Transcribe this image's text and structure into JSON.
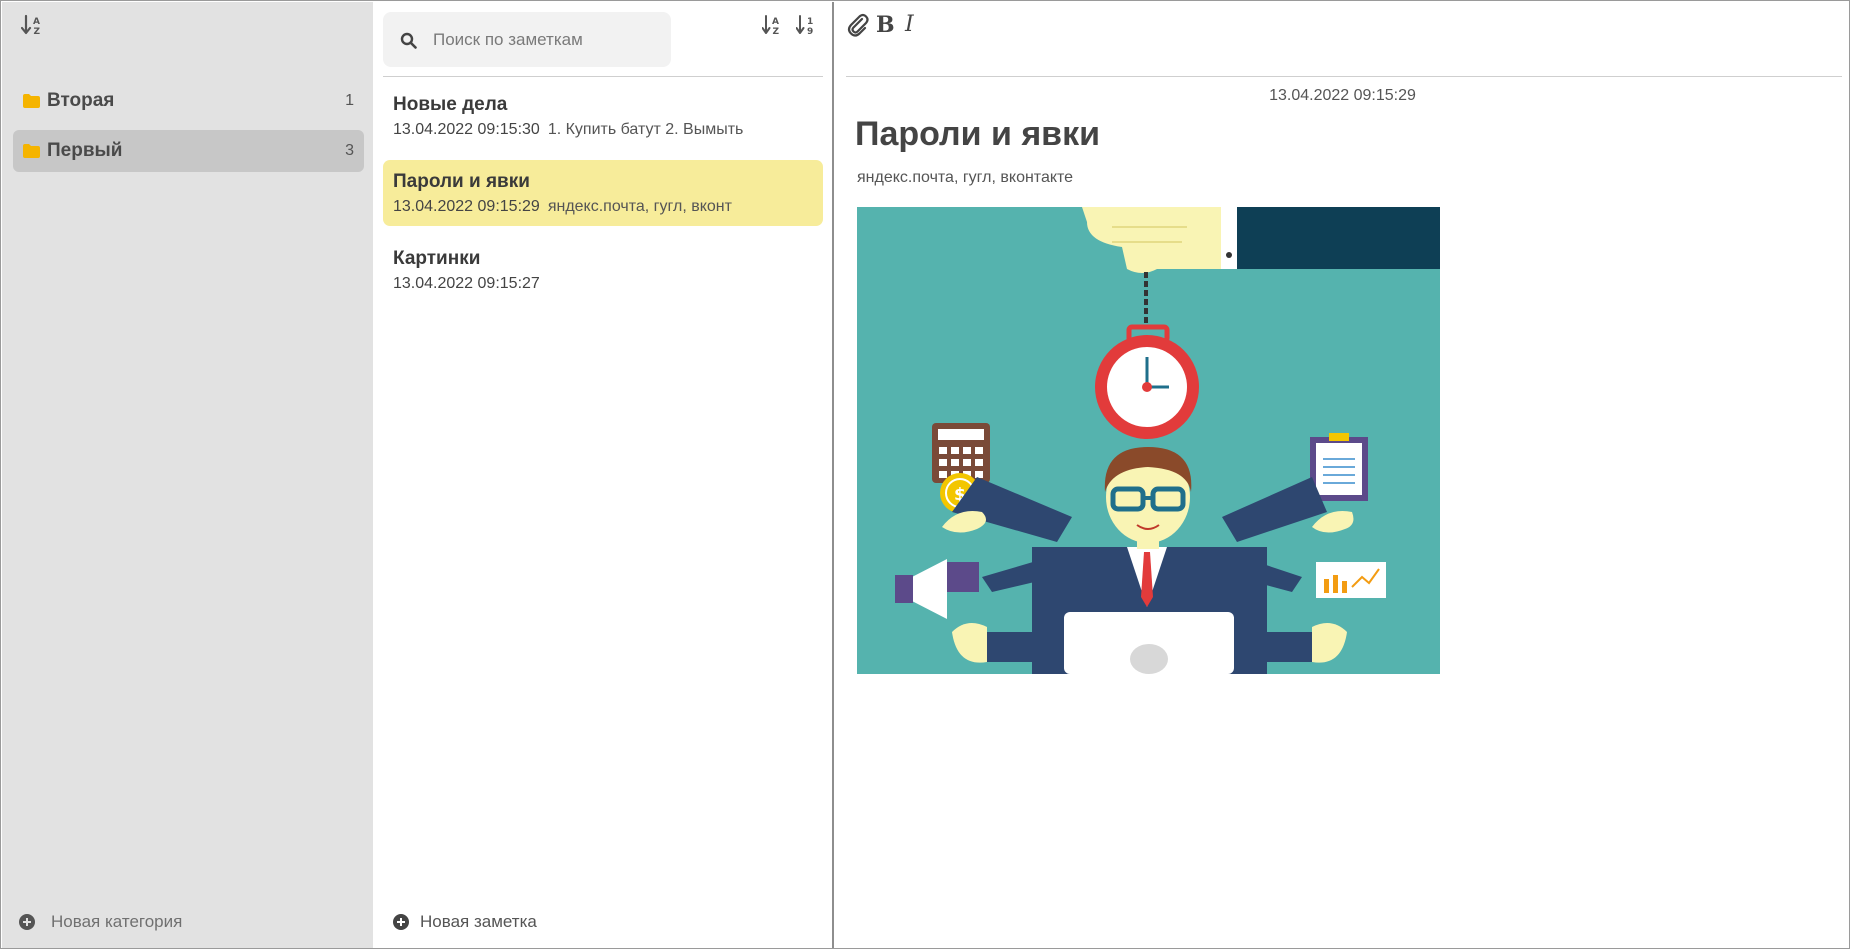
{
  "sidebar": {
    "categories": [
      {
        "label": "Вторая",
        "count": "1"
      },
      {
        "label": "Первый",
        "count": "3"
      }
    ],
    "new_category_label": "Новая категория"
  },
  "notes": {
    "search_placeholder": "Поиск по заметкам",
    "items": [
      {
        "title": "Новые дела",
        "date": "13.04.2022 09:15:30",
        "preview": "1. Купить батут 2. Вымыть"
      },
      {
        "title": "Пароли и явки",
        "date": "13.04.2022 09:15:29",
        "preview": "яндекс.почта, гугл, вконт"
      },
      {
        "title": "Картинки",
        "date": "13.04.2022 09:15:27",
        "preview": ""
      }
    ],
    "new_note_label": "Новая заметка"
  },
  "editor": {
    "date": "13.04.2022 09:15:29",
    "heading": "Пароли и явки",
    "body": "яндекс.почта, гугл, вконтакте",
    "bold_label": "B",
    "italic_label": "I"
  },
  "colors": {
    "sidebar_bg": "#e2e2e2",
    "active_category": "#c7c7c7",
    "active_note": "#f7ec9a",
    "folder_icon": "#f5b400",
    "illustration_bg": "#55b3ae"
  },
  "icons": {
    "sort_categories": "sort-alpha-icon",
    "folder": "folder-icon",
    "search": "search-icon",
    "sort_notes_alpha": "sort-alpha-icon",
    "sort_notes_numeric": "sort-numeric-icon",
    "attach": "paperclip-icon",
    "add": "plus-circle-icon"
  }
}
